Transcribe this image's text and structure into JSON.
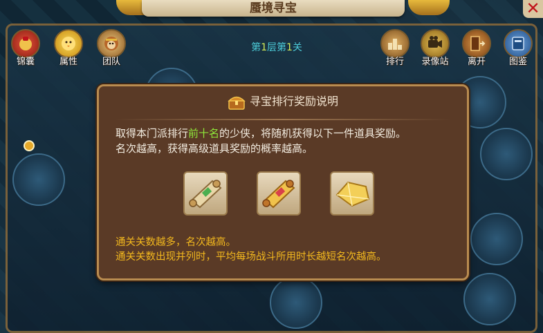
{
  "window": {
    "title": "蜃境寻宝",
    "close_label": "✕"
  },
  "level": {
    "prefix": "第",
    "floor": "1",
    "mid": "层第",
    "stage": "1",
    "suffix": "关"
  },
  "left_tools": [
    {
      "label": "锦囊",
      "icon": "bag-icon"
    },
    {
      "label": "属性",
      "icon": "chick-icon"
    },
    {
      "label": "团队",
      "icon": "monkey-icon"
    }
  ],
  "right_tools": [
    {
      "label": "排行",
      "icon": "ranking-icon"
    },
    {
      "label": "录像站",
      "icon": "video-icon"
    },
    {
      "label": "离开",
      "icon": "exit-door-icon"
    },
    {
      "label": "图鉴",
      "icon": "book-icon"
    }
  ],
  "dialog": {
    "title": "寻宝排行奖励说明",
    "desc_part1": "取得本门派排行",
    "desc_highlight": "前十名",
    "desc_part2": "的少侠，将随机获得以下一件道具奖励。",
    "desc_line2": "名次越高，获得高级道具奖励的概率越高。",
    "rewards": [
      {
        "icon": "scroll-green-icon"
      },
      {
        "icon": "scroll-gold-icon"
      },
      {
        "icon": "gold-crystal-icon"
      }
    ],
    "note_line1": "通关关数越多，名次越高。",
    "note_line2": "通关关数出现并列时，平均每场战斗所用时长越短名次越高。"
  },
  "colors": {
    "highlight_green": "#8fe83a",
    "note_gold": "#f2b81e",
    "level_cyan": "#4ccbd8"
  }
}
